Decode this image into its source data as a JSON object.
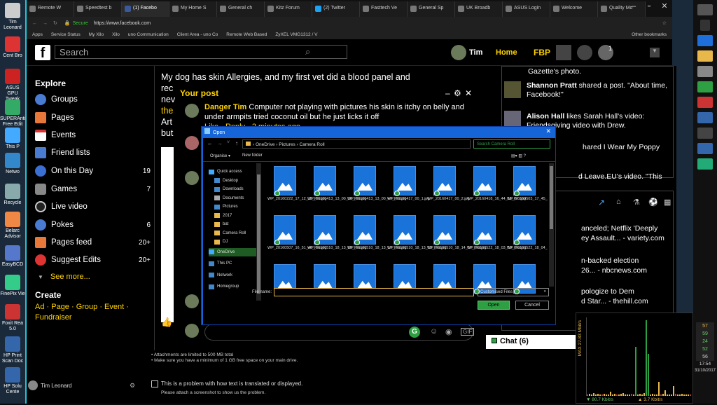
{
  "desktop": {
    "icons": [
      "Tim Leonard",
      "Cent Bro",
      "ASUS GPU Tweak",
      "SUPERAnti Free Edit",
      "This P",
      "Netwo",
      "Recycle",
      "Belarc Advisor",
      "EasyBCD",
      "FinePix Vie",
      "Foxit Rea 5.0",
      "HP Print Scan Doc",
      "HP Solu Cente"
    ]
  },
  "browser": {
    "tabs": [
      "Remote W",
      "Speedtest b",
      "(1) Facebo",
      "My Home S",
      "General ch",
      "Kitz Forum",
      "(2) Twitter",
      "Fasttech Ve",
      "General Sp",
      "UK Broadb",
      "ASUS Login",
      "Welcome",
      "Quality Mo"
    ],
    "secure_label": "Secure",
    "url": "https://www.facebook.com",
    "bookmarks": [
      "Apps",
      "Service Status",
      "My Xilo",
      "Xilo",
      "uno Communication",
      "Client Area - uno Co",
      "Remote Web Based",
      "ZyXEL VMG1312 / V"
    ],
    "other_bookmarks": "Other bookmarks"
  },
  "facebook": {
    "search_placeholder": "Search",
    "user_name": "Tim",
    "home_label": "Home",
    "fbp_label": "FBP",
    "notif_count": "1",
    "explore_heading": "Explore",
    "nav": [
      {
        "label": "Groups",
        "count": ""
      },
      {
        "label": "Pages",
        "count": ""
      },
      {
        "label": "Events",
        "count": ""
      },
      {
        "label": "Friend lists",
        "count": ""
      },
      {
        "label": "On this Day",
        "count": "19"
      },
      {
        "label": "Games",
        "count": "7"
      },
      {
        "label": "Live video",
        "count": ""
      },
      {
        "label": "Pokes",
        "count": "6"
      },
      {
        "label": "Pages feed",
        "count": "20+"
      },
      {
        "label": "Suggest Edits",
        "count": "20+"
      }
    ],
    "see_more": "See more...",
    "create_heading": "Create",
    "create_links_1": "Ad · Page · Group · Event ·",
    "create_links_2": "Fundraiser",
    "bottom_user": "Tim Leonard"
  },
  "post": {
    "text_line1": "My dog has skin Allergies, and my first vet did a blood panel and",
    "text_line2": "rec",
    "text_line3": "nev",
    "text_line4": "the",
    "text_line5": "Art",
    "text_line6": "but",
    "your_post": "Your post",
    "comment_author": "Danger Tim",
    "comment_text_1": "Computer not playing with pictures his skin is itchy on belly and",
    "comment_text_2": "under armpits tried coconut oil but he just licks it off",
    "comment_actions": "Like · Reply · 2 minutes ago",
    "attach_note_1": "• Attachments are limited to 500 MB total",
    "attach_note_2": "• Make sure you have a minimum of 1 GB free space on your main drive.",
    "checkbox_label": "This is a problem with how text is translated or displayed.",
    "screenshot_note": "Please attach a screenshot to show us the problem."
  },
  "ticker": [
    {
      "name": "",
      "text": "Gazette's photo."
    },
    {
      "name": "Shannon Pratt",
      "text": " shared a post. \"About time, Facebook!\""
    },
    {
      "name": "Alison Hall",
      "text": " likes Sarah Hall's video: Friendsgiving video with Drew."
    },
    {
      "name": "",
      "text": "hared I Wear My Poppy"
    },
    {
      "name": "",
      "text": "d Leave.EU's video. \"This"
    }
  ],
  "news": [
    "anceled; Netflix 'Deeply",
    "ey Assault... - variety.com",
    "n-backed election",
    "26... - nbcnews.com",
    "pologize to Dem",
    "d Star... - thehill.com"
  ],
  "chat_label": "Chat (6)",
  "dialog": {
    "title": "Open",
    "path": [
      "OneDrive",
      "Pictures",
      "Camera Roll"
    ],
    "search_placeholder": "Search Camera Roll",
    "organise": "Organise ▾",
    "new_folder": "New folder",
    "tree": [
      "Quick access",
      "Desktop",
      "Downloads",
      "Documents",
      "Pictures",
      "2017",
      "bat",
      "Camera Roll",
      "DJ",
      "OneDrive",
      "This PC",
      "Network",
      "Homegroup"
    ],
    "files": [
      "WP_20160222_17_12_15_Pro.jpg",
      "WP_20160413_13_00_36_Pro.jpg",
      "WP_20160413_13_00_47_Pro.jpg",
      "WP_20160417_00_1.jpg",
      "WP_20160417_00_2.jpg",
      "WP_20160418_16_44_11_Pro.jpg",
      "WP_20160503_17_45_17_Pro.jpg",
      "WP_20160507_16_51_46_Pro.jpg",
      "WP_20160510_18_13_09_Pro.jpg",
      "WP_20160510_18_13_17_Pro.jpg",
      "WP_20160510_18_13_23_Pro.jpg",
      "WP_20160510_18_14_07_Pro.jpg",
      "WP_20160522_18_03_59_Pro.jpg",
      "WP_20160522_18_04_07_Pro.jpg",
      "",
      "",
      "",
      "",
      "",
      "",
      ""
    ],
    "file_name_label": "File name:",
    "filter": "Customised Files",
    "open_button": "Open",
    "cancel_button": "Cancel"
  },
  "netmon": {
    "label": "MAX 27.83 Mbit/s",
    "down": "▼ 80.7 Kbit/s",
    "up": "▲ 3.7 Kbit/s"
  },
  "taskbar": {
    "badges": [
      "57",
      "59",
      "24",
      "52",
      "56"
    ],
    "time": "17:54",
    "date": "31/10/2017"
  },
  "colors": {
    "accent": "#ffd400",
    "dialog": "#1565d8",
    "green": "#2ea043"
  }
}
